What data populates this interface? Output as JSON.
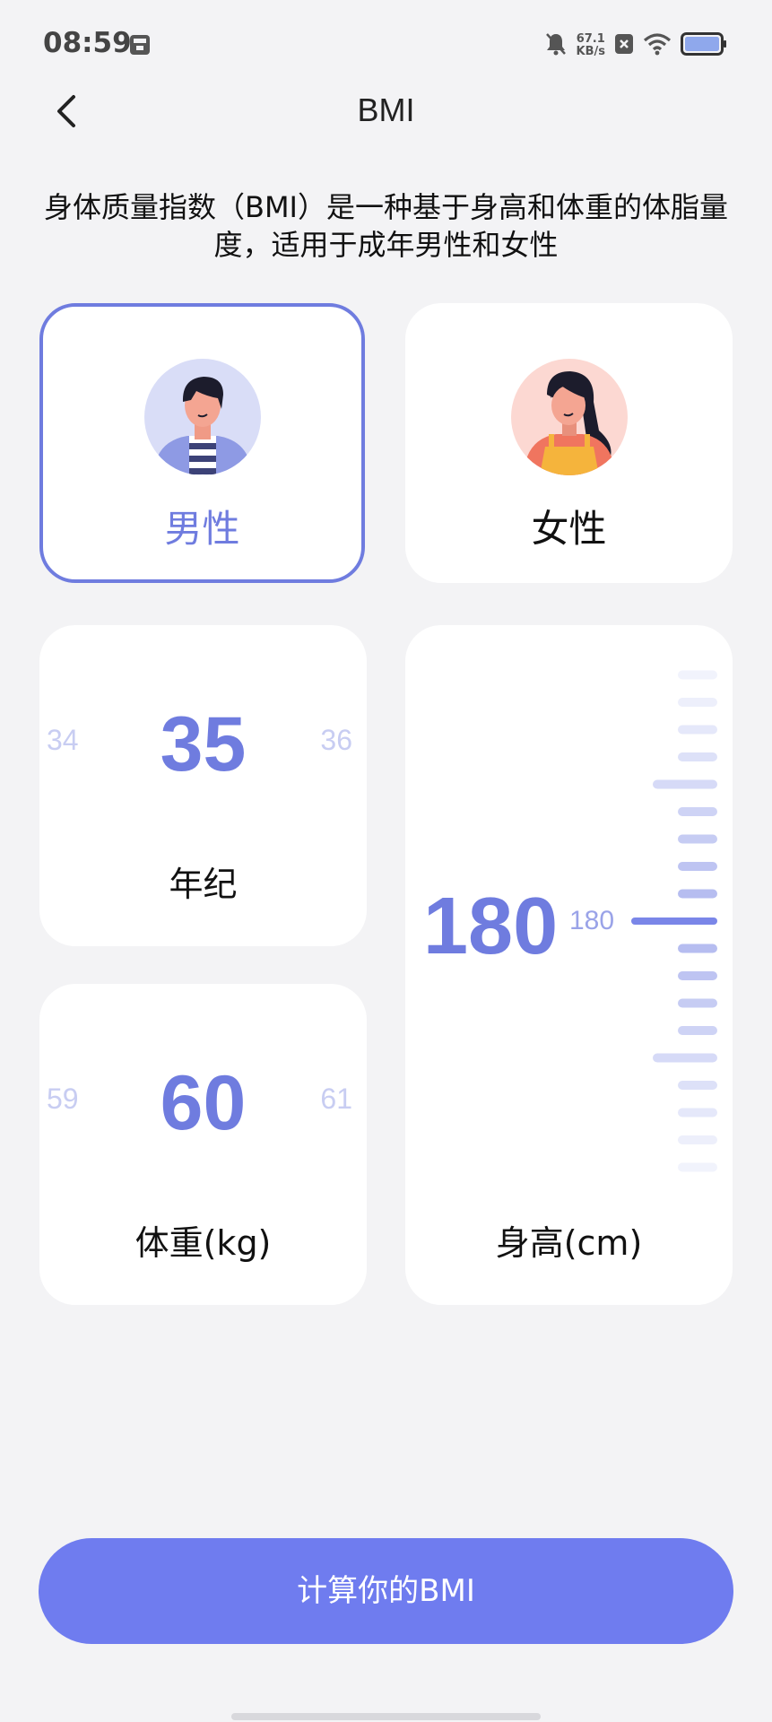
{
  "status_bar": {
    "time": "08:59",
    "net_speed_value": "67.1",
    "net_speed_unit": "KB/s",
    "icons": [
      "app-notification-icon",
      "mute-icon",
      "close-box-icon",
      "wifi-icon",
      "battery-icon"
    ]
  },
  "nav": {
    "title": "BMI",
    "back_icon": "back-arrow-icon"
  },
  "description": "身体质量指数（BMI）是一种基于身高和体重的体脂量度，适用于成年男性和女性",
  "gender": {
    "male_label": "男性",
    "female_label": "女性",
    "selected": "male"
  },
  "age": {
    "prev": "34",
    "value": "35",
    "next": "36",
    "label": "年纪"
  },
  "weight": {
    "prev": "59",
    "value": "60",
    "next": "61",
    "label": "体重(kg)"
  },
  "height": {
    "value": "180",
    "tick_label": "180",
    "label": "身高(cm)"
  },
  "action": {
    "calculate_label": "计算你的BMI"
  },
  "colors": {
    "accent": "#6f7cdf",
    "button": "#6f7cef",
    "background": "#f3f3f5"
  }
}
